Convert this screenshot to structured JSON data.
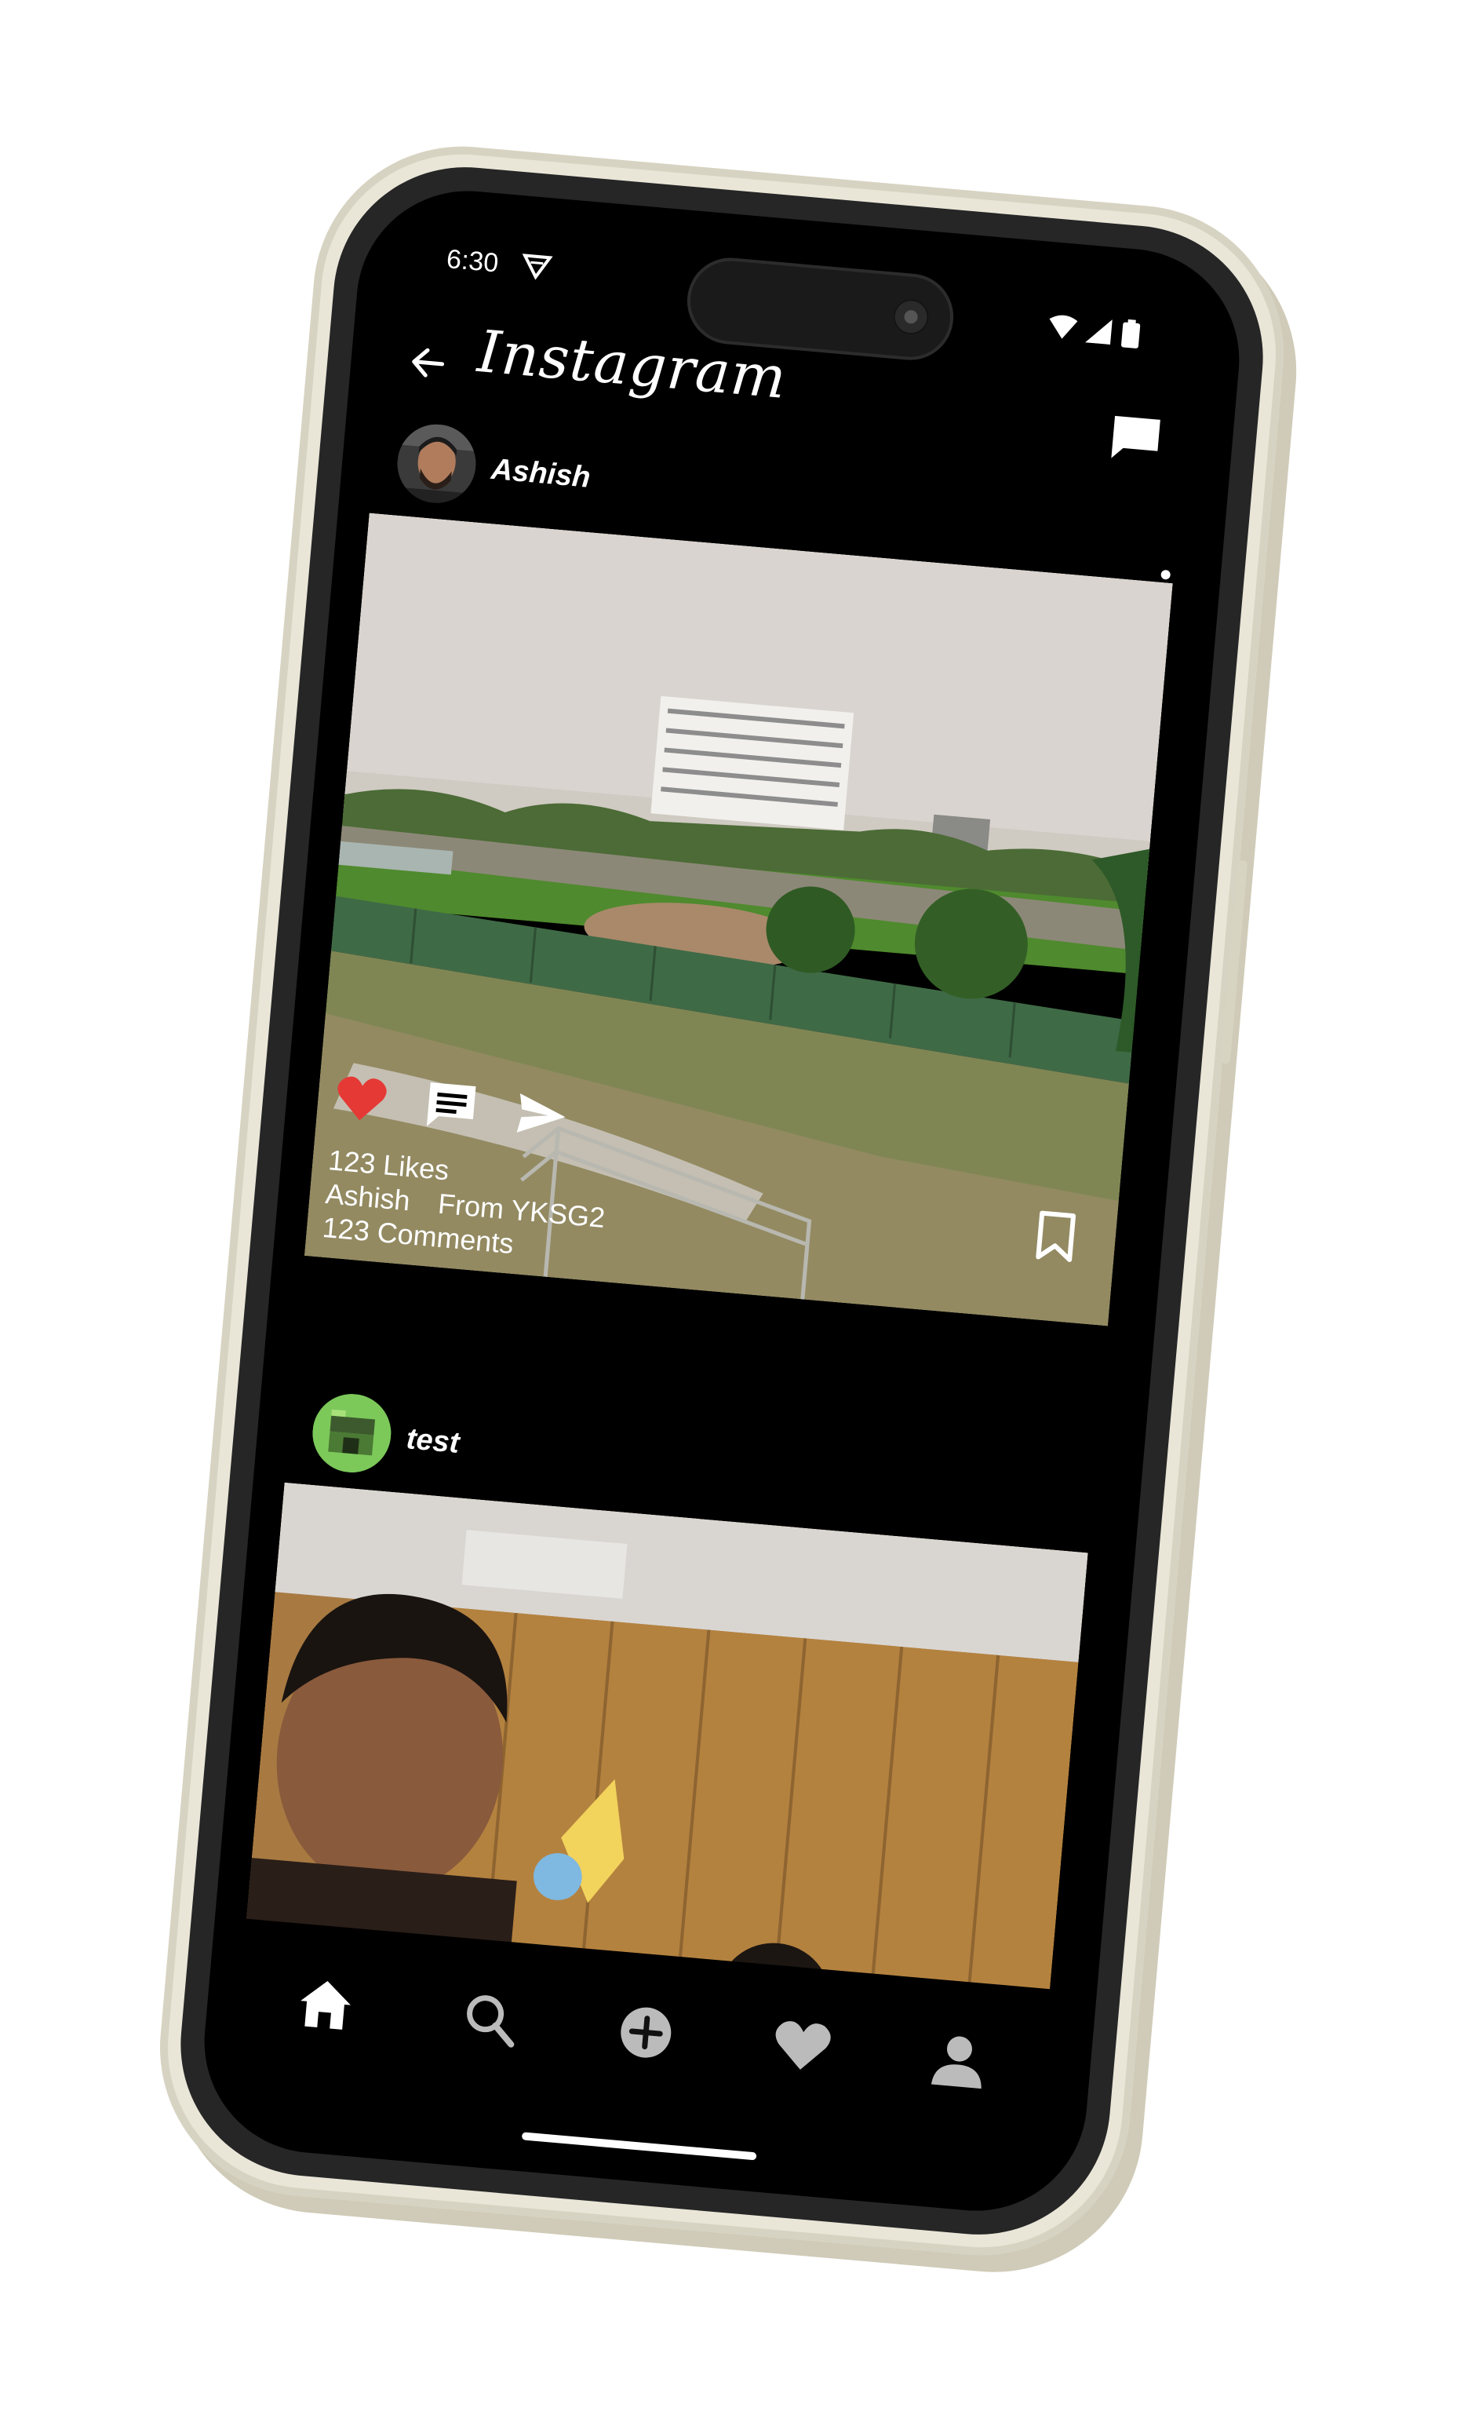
{
  "status_bar": {
    "time": "6:30"
  },
  "app_bar": {
    "title": "Instagram"
  },
  "posts": [
    {
      "username": "Ashish",
      "likes": "123 Likes",
      "caption_user": "Ashish",
      "caption_text": "From YKSG2",
      "comments": "123 Comments",
      "liked": true
    },
    {
      "username": "test"
    }
  ],
  "bottom_nav": {
    "items": [
      "home-icon",
      "search-icon",
      "add-icon",
      "heart-icon",
      "profile-icon"
    ],
    "active": "home-icon"
  },
  "colors": {
    "like_red": "#e53935",
    "frame": "#e9e6d8",
    "screen": "#000000"
  }
}
